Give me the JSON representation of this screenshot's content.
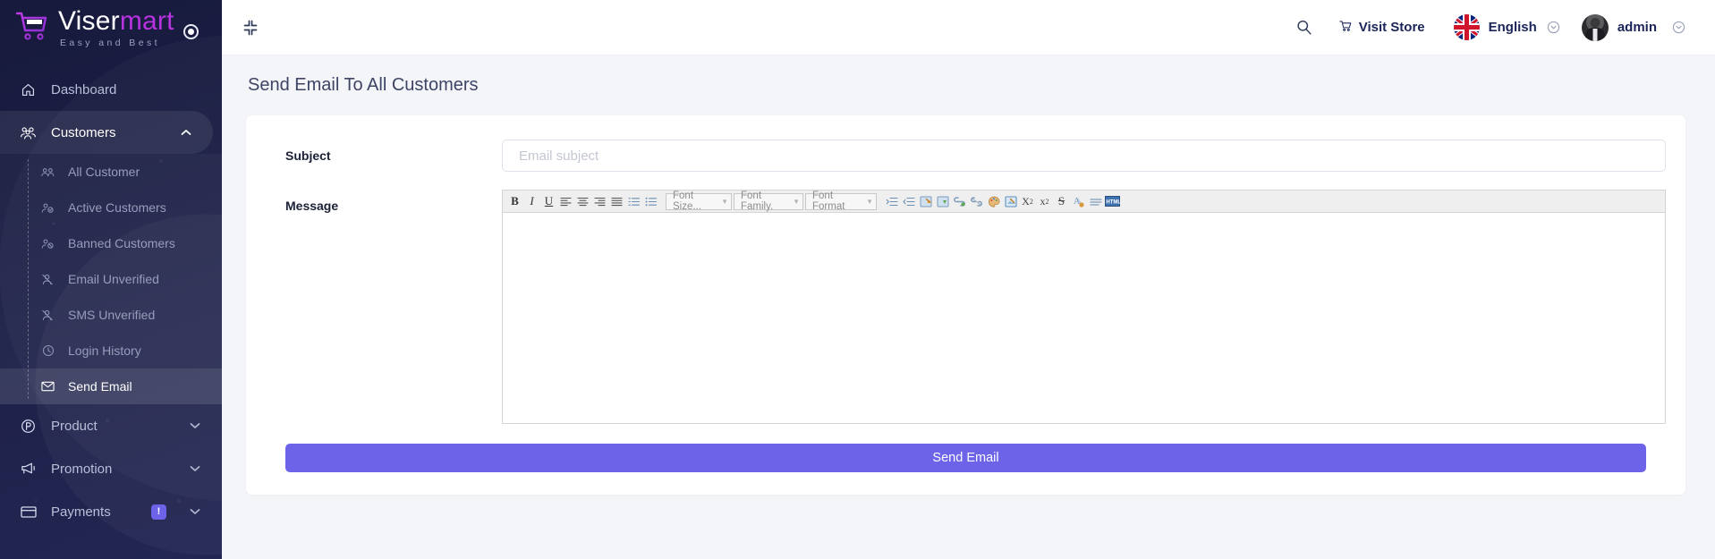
{
  "brand": {
    "name_first": "Viser",
    "name_second": "mart",
    "tagline": "Easy and Best",
    "logo_icon": "shopping-cart-icon",
    "status_icon": "record-dot-icon"
  },
  "sidebar": {
    "items": [
      {
        "label": "Dashboard",
        "icon": "home-icon",
        "active": false,
        "has_caret": false
      },
      {
        "label": "Customers",
        "icon": "users-group-icon",
        "active": true,
        "has_caret": true,
        "caret": "chevron-up-icon"
      },
      {
        "label": "Product",
        "icon": "product-circle-icon",
        "active": false,
        "has_caret": true,
        "caret": "chevron-down-icon"
      },
      {
        "label": "Promotion",
        "icon": "megaphone-icon",
        "active": false,
        "has_caret": true,
        "caret": "chevron-down-icon"
      },
      {
        "label": "Payments",
        "icon": "credit-card-icon",
        "active": false,
        "has_caret": true,
        "caret": "chevron-down-icon",
        "badge": "!"
      }
    ],
    "customers_submenu": [
      {
        "label": "All Customer",
        "icon": "users-icon",
        "active": false
      },
      {
        "label": "Active Customers",
        "icon": "user-check-icon",
        "active": false
      },
      {
        "label": "Banned Customers",
        "icon": "user-block-icon",
        "active": false
      },
      {
        "label": "Email Unverified",
        "icon": "user-slash-icon",
        "active": false
      },
      {
        "label": "SMS Unverified",
        "icon": "user-slash-icon",
        "active": false
      },
      {
        "label": "Login History",
        "icon": "clock-icon",
        "active": false
      },
      {
        "label": "Send Email",
        "icon": "envelope-icon",
        "active": true
      }
    ]
  },
  "topbar": {
    "collapse_icon": "compress-arrows-icon",
    "search_icon": "search-icon",
    "visit_store_label": "Visit Store",
    "visit_store_icon": "cart-icon",
    "language_label": "English",
    "language_flag": "uk-flag-icon",
    "language_caret": "chevron-down-circle-icon",
    "user_label": "admin",
    "user_avatar": "user-avatar",
    "user_caret": "chevron-down-circle-icon"
  },
  "main": {
    "page_title": "Send Email To All Customers",
    "form": {
      "subject_label": "Subject",
      "subject_placeholder": "Email subject",
      "subject_value": "",
      "message_label": "Message",
      "message_value": ""
    },
    "editor_toolbar": {
      "buttons": [
        {
          "name": "bold-icon",
          "glyph": "B",
          "style": "bold-serif"
        },
        {
          "name": "italic-icon",
          "glyph": "I",
          "style": "italic-serif"
        },
        {
          "name": "underline-icon",
          "glyph": "U",
          "style": "underline-serif"
        },
        {
          "name": "align-left-icon",
          "glyph": "≡",
          "style": "plain"
        },
        {
          "name": "align-center-icon",
          "glyph": "≡",
          "style": "plain"
        },
        {
          "name": "align-right-icon",
          "glyph": "≡",
          "style": "plain"
        },
        {
          "name": "align-justify-icon",
          "glyph": "≣",
          "style": "plain"
        },
        {
          "name": "ordered-list-icon",
          "glyph": "⒈",
          "style": "list"
        },
        {
          "name": "unordered-list-icon",
          "glyph": "⁞",
          "style": "list"
        }
      ],
      "selects": [
        {
          "name": "font-size-select",
          "label": "Font Size..."
        },
        {
          "name": "font-family-select",
          "label": "Font Family."
        },
        {
          "name": "font-format-select",
          "label": "Font Format"
        }
      ],
      "buttons2": [
        {
          "name": "indent-icon",
          "glyph": "⇥"
        },
        {
          "name": "outdent-icon",
          "glyph": "⇤"
        },
        {
          "name": "insert-image-icon",
          "glyph": "▤"
        },
        {
          "name": "insert-form-icon",
          "glyph": "▥"
        },
        {
          "name": "insert-link-icon",
          "glyph": "🔗"
        },
        {
          "name": "unlink-icon",
          "glyph": "⛓"
        },
        {
          "name": "color-palette-icon",
          "glyph": "🎨"
        },
        {
          "name": "image-editor-icon",
          "glyph": "▣"
        },
        {
          "name": "subscript-icon",
          "glyph": "X₂"
        },
        {
          "name": "superscript-icon",
          "glyph": "x²"
        },
        {
          "name": "strikethrough-icon",
          "glyph": "S"
        },
        {
          "name": "font-color-icon",
          "glyph": "A"
        },
        {
          "name": "horizontal-rule-icon",
          "glyph": "▬"
        },
        {
          "name": "html-source-icon",
          "glyph": "HTML"
        }
      ]
    },
    "send_button_label": "Send Email"
  },
  "colors": {
    "sidebar_bg": "#1c1f44",
    "accent_purple": "#6c63e8",
    "brand_magenta": "#b833e0",
    "page_bg": "#f4f5f8",
    "text_dark": "#1b2559"
  }
}
